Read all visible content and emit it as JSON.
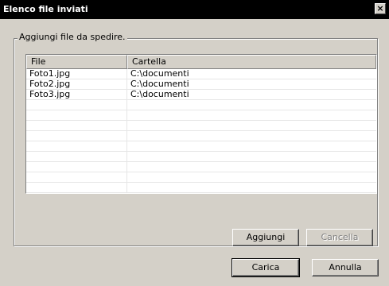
{
  "window": {
    "title": "Elenco file inviati",
    "close_glyph": "×"
  },
  "group": {
    "label": "Aggiungi file da spedire."
  },
  "list": {
    "columns": [
      "File",
      "Cartella"
    ],
    "rows": [
      {
        "file": "Foto1.jpg",
        "cartella": "C:\\documenti"
      },
      {
        "file": "Foto2.jpg",
        "cartella": "C:\\documenti"
      },
      {
        "file": "Foto3.jpg",
        "cartella": "C:\\documenti"
      }
    ]
  },
  "buttons": {
    "aggiungi": {
      "label": "Aggiungi",
      "enabled": true
    },
    "cancella": {
      "label": "Cancella",
      "enabled": false
    },
    "carica": {
      "label": "Carica",
      "enabled": true,
      "default": true
    },
    "annulla": {
      "label": "Annulla",
      "enabled": true
    }
  }
}
